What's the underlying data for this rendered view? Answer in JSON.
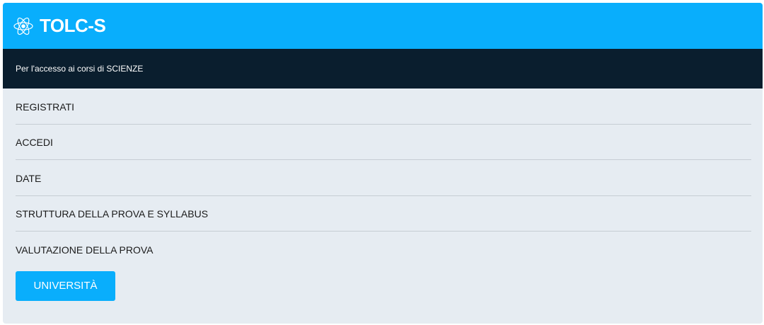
{
  "header": {
    "title": "TOLC-S",
    "logo_icon": "atom-icon",
    "background": "#09aefc"
  },
  "subheader": {
    "text": "Per l'accesso ai corsi di SCIENZE",
    "background": "#0a1e2e"
  },
  "menu": {
    "items": [
      {
        "label": "REGISTRATI"
      },
      {
        "label": "ACCEDI"
      },
      {
        "label": "DATE"
      },
      {
        "label": "STRUTTURA DELLA PROVA E SYLLABUS"
      },
      {
        "label": "VALUTAZIONE DELLA PROVA"
      }
    ]
  },
  "button": {
    "label": "UNIVERSITÀ",
    "color": "#09aefc"
  }
}
